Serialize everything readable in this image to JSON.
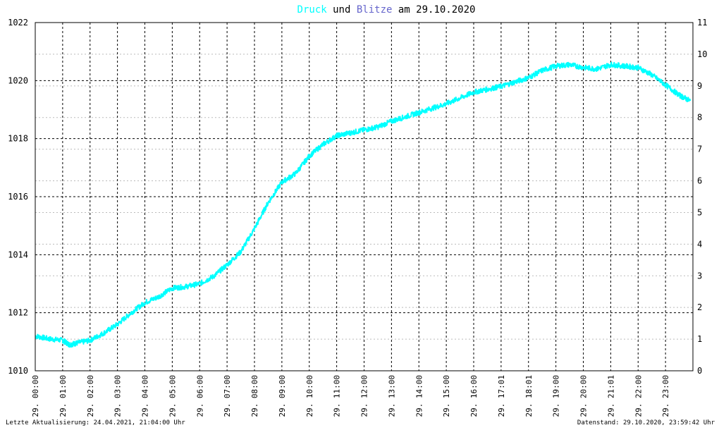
{
  "chart_data": {
    "type": "line",
    "title": {
      "part1": "Druck",
      "part2": " und ",
      "part3": "Blitze",
      "part4": " am 29.10.2020"
    },
    "colors": {
      "druck": "#00ffff",
      "blitze": "#6666cc",
      "text": "#000000",
      "grid": "#000000",
      "minor_grid": "#bbbbbb",
      "background": "#ffffff"
    },
    "y_left": {
      "min": 1010,
      "max": 1022,
      "ticks": [
        1010,
        1012,
        1014,
        1016,
        1018,
        1020,
        1022
      ]
    },
    "y_right": {
      "min": 0,
      "max": 11,
      "ticks": [
        0,
        1,
        2,
        3,
        4,
        5,
        6,
        7,
        8,
        9,
        10,
        11
      ]
    },
    "x_range_hours": [
      0,
      24
    ],
    "x_ticks": [
      {
        "h": 0,
        "label": "29. 00:00"
      },
      {
        "h": 1,
        "label": "29. 01:00"
      },
      {
        "h": 2,
        "label": "29. 02:00"
      },
      {
        "h": 3,
        "label": "29. 03:00"
      },
      {
        "h": 4,
        "label": "29. 04:00"
      },
      {
        "h": 5,
        "label": "29. 05:00"
      },
      {
        "h": 6,
        "label": "29. 06:00"
      },
      {
        "h": 7,
        "label": "29. 07:00"
      },
      {
        "h": 8,
        "label": "29. 08:00"
      },
      {
        "h": 9,
        "label": "29. 09:00"
      },
      {
        "h": 10,
        "label": "29. 10:00"
      },
      {
        "h": 11,
        "label": "29. 11:00"
      },
      {
        "h": 12,
        "label": "29. 12:00"
      },
      {
        "h": 13,
        "label": "29. 13:00"
      },
      {
        "h": 14,
        "label": "29. 14:00"
      },
      {
        "h": 15,
        "label": "29. 15:00"
      },
      {
        "h": 16,
        "label": "29. 16:00"
      },
      {
        "h": 17,
        "label": "29. 17:01"
      },
      {
        "h": 18,
        "label": "29. 18:01"
      },
      {
        "h": 19,
        "label": "29. 19:00"
      },
      {
        "h": 20,
        "label": "29. 20:00"
      },
      {
        "h": 21,
        "label": "29. 21:01"
      },
      {
        "h": 22,
        "label": "29. 22:00"
      },
      {
        "h": 23,
        "label": "29. 23:00"
      }
    ],
    "grid": true,
    "series": [
      {
        "color": "#00ffff",
        "x_hours": [
          0,
          0.5,
          1,
          1.25,
          1.5,
          2,
          2.5,
          3,
          3.5,
          4,
          4.5,
          5,
          5.5,
          6,
          6.5,
          7,
          7.5,
          8,
          8.5,
          9,
          9.5,
          10,
          10.5,
          11,
          11.5,
          12,
          12.5,
          13,
          13.5,
          14,
          14.5,
          15,
          15.5,
          16,
          16.5,
          17,
          17.5,
          18,
          18.5,
          19,
          19.5,
          20,
          20.5,
          21,
          21.5,
          22,
          22.5,
          23,
          23.5,
          23.9
        ],
        "values": [
          1011.2,
          1011.1,
          1011.05,
          1010.9,
          1010.95,
          1011.05,
          1011.3,
          1011.6,
          1012.0,
          1012.35,
          1012.55,
          1012.85,
          1012.9,
          1013.0,
          1013.25,
          1013.65,
          1014.1,
          1014.9,
          1015.8,
          1016.5,
          1016.8,
          1017.4,
          1017.8,
          1018.1,
          1018.2,
          1018.3,
          1018.4,
          1018.6,
          1018.75,
          1018.9,
          1019.05,
          1019.2,
          1019.4,
          1019.6,
          1019.7,
          1019.8,
          1019.95,
          1020.1,
          1020.35,
          1020.5,
          1020.55,
          1020.45,
          1020.4,
          1020.55,
          1020.5,
          1020.45,
          1020.2,
          1019.85,
          1019.5,
          1019.3
        ]
      }
    ]
  },
  "footer": {
    "left": "Letzte Aktualisierung: 24.04.2021, 21:04:00 Uhr",
    "right": "Datenstand: 29.10.2020, 23:59:42 Uhr"
  }
}
